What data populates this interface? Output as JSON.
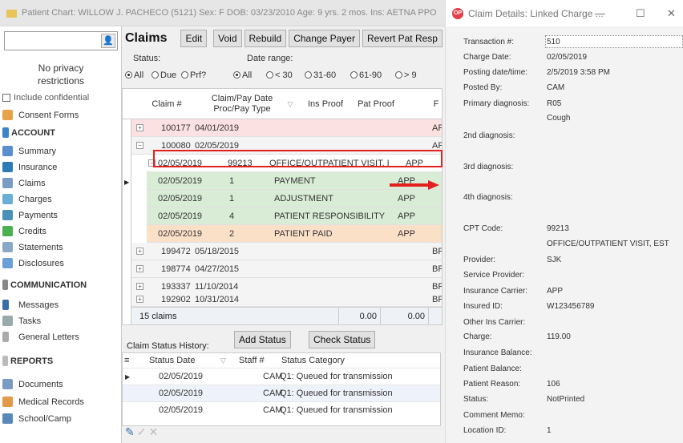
{
  "main_window": {
    "title": "Patient Chart: WILLOW J. PACHECO (5121)  Sex: F  DOB: 03/23/2010  Age: 9 yrs. 2 mos.  Ins: AETNA PPO"
  },
  "left_panel": {
    "privacy_line1": "No privacy",
    "privacy_line2": "restrictions",
    "include_confidential": "Include confidential",
    "consent_forms": "Consent Forms",
    "account_header": "ACCOUNT",
    "account_items": [
      "Summary",
      "Insurance",
      "Claims",
      "Charges",
      "Payments",
      "Credits",
      "Statements",
      "Disclosures"
    ],
    "communication_header": "COMMUNICATION",
    "communication_items": [
      "Messages",
      "Tasks",
      "General Letters"
    ],
    "reports_header": "REPORTS",
    "reports_items": [
      "Documents",
      "Medical Records",
      "School/Camp"
    ]
  },
  "toolbar": {
    "title": "Claims",
    "buttons": [
      "Edit",
      "Void",
      "Rebuild",
      "Change Payer",
      "Revert Pat Resp"
    ]
  },
  "filters": {
    "status_label": "Status:",
    "status_options": [
      "All",
      "Due",
      "Prf?"
    ],
    "date_range_label": "Date range:",
    "date_options": [
      "All",
      "< 30",
      "31-60",
      "61-90",
      "> 9"
    ]
  },
  "claims_grid": {
    "columns": [
      "Claim #",
      "Claim/Pay Date Proc/Pay Type",
      "Ins Proof",
      "Pat Proof",
      "F"
    ],
    "claim_rows": [
      {
        "claim": "100177",
        "date": "04/01/2019",
        "flag": "APP"
      },
      {
        "claim": "100080",
        "date": "02/05/2019",
        "flag": "APP"
      }
    ],
    "sub_rows": [
      {
        "date": "02/05/2019",
        "num": "99213",
        "desc": "OFFICE/OUTPATIENT VISIT, I",
        "payer": "APP"
      },
      {
        "date": "02/05/2019",
        "num": "1",
        "desc": "PAYMENT",
        "payer": "APP"
      },
      {
        "date": "02/05/2019",
        "num": "1",
        "desc": "ADJUSTMENT",
        "payer": "APP"
      },
      {
        "date": "02/05/2019",
        "num": "4",
        "desc": "PATIENT RESPONSIBILITY",
        "payer": "APP"
      },
      {
        "date": "02/05/2019",
        "num": "2",
        "desc": "PATIENT PAID",
        "payer": "APP"
      }
    ],
    "more_rows": [
      {
        "claim": "199472",
        "date": "05/18/2015",
        "flag": "BPC"
      },
      {
        "claim": "198774",
        "date": "04/27/2015",
        "flag": "BPC"
      },
      {
        "claim": "193337",
        "date": "11/10/2014",
        "flag": "BPC"
      },
      {
        "claim": "192902",
        "date": "10/31/2014",
        "flag": "BPC"
      }
    ],
    "footer_count": "15 claims",
    "footer_ins": "0.00",
    "footer_pat": "0.00"
  },
  "status_history": {
    "label": "Claim Status History:",
    "add_button": "Add Status",
    "check_button": "Check Status",
    "columns": [
      "Status Date",
      "Staff #",
      "Status Category"
    ],
    "rows": [
      {
        "date": "02/05/2019",
        "staff": "CAM",
        "category": "Q1: Queued for transmission"
      },
      {
        "date": "02/05/2019",
        "staff": "CAM",
        "category": "Q1: Queued for transmission"
      },
      {
        "date": "02/05/2019",
        "staff": "CAM",
        "category": "Q1: Queued for transmission"
      }
    ]
  },
  "details_window": {
    "title": "Claim Details: Linked Charge ...",
    "fields": [
      {
        "label": "Transaction #:",
        "value": "510"
      },
      {
        "label": "Charge Date:",
        "value": "02/05/2019"
      },
      {
        "label": "Posting date/time:",
        "value": "2/5/2019 3:58 PM"
      },
      {
        "label": "Posted By:",
        "value": "CAM"
      },
      {
        "label": "Primary diagnosis:",
        "value": "R05"
      },
      {
        "label": "",
        "value": "Cough"
      },
      {
        "label": "2nd diagnosis:",
        "value": ""
      },
      {
        "label": "3rd diagnosis:",
        "value": ""
      },
      {
        "label": "4th diagnosis:",
        "value": ""
      },
      {
        "label": "CPT Code:",
        "value": "99213"
      },
      {
        "label": "",
        "value": "OFFICE/OUTPATIENT VISIT, EST"
      },
      {
        "label": "Provider:",
        "value": "SJK"
      },
      {
        "label": "Service Provider:",
        "value": ""
      },
      {
        "label": "Insurance Carrier:",
        "value": "APP"
      },
      {
        "label": "Insured ID:",
        "value": "W123456789"
      },
      {
        "label": "Other Ins Carrier:",
        "value": ""
      },
      {
        "label": "Charge:",
        "value": "119.00"
      },
      {
        "label": "Insurance Balance:",
        "value": ""
      },
      {
        "label": "Patient Balance:",
        "value": ""
      },
      {
        "label": "Patient Reason:",
        "value": "106"
      },
      {
        "label": "Status:",
        "value": "NotPrinted"
      },
      {
        "label": "Comment Memo:",
        "value": ""
      },
      {
        "label": "Location ID:",
        "value": "1"
      }
    ]
  }
}
